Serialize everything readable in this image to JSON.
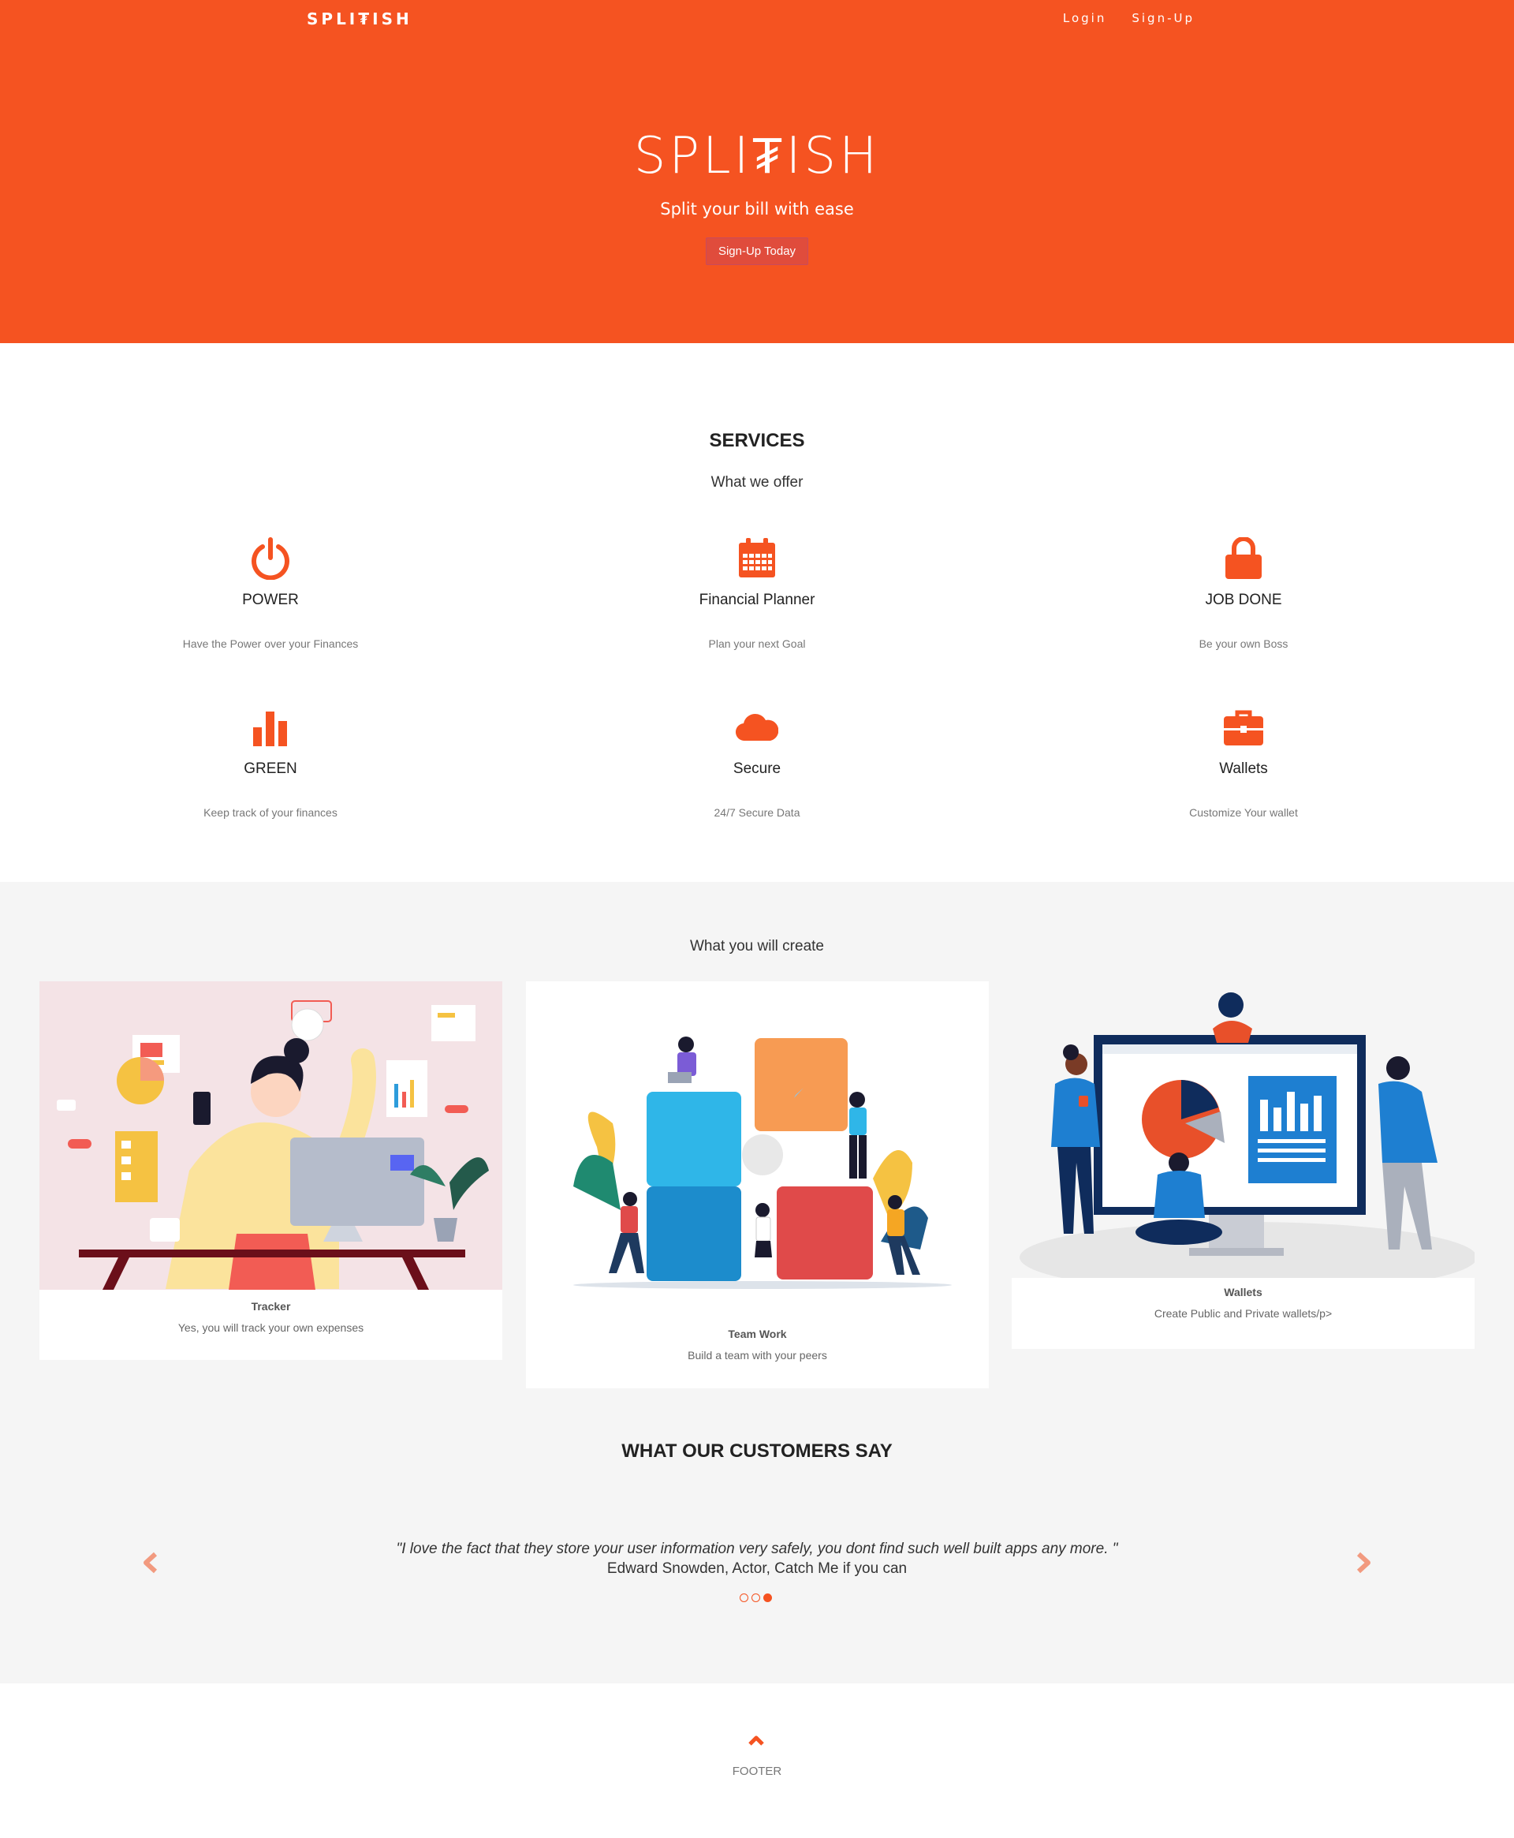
{
  "header": {
    "brand": "SPLI₮ISH",
    "nav": {
      "login": "Login",
      "signup": "Sign-Up"
    }
  },
  "hero": {
    "title": "SPLI₮ISH",
    "subtitle": "Split your bill with ease",
    "cta": "Sign-Up Today"
  },
  "colors": {
    "accent": "#f55321",
    "section_bg": "#f5f5f5"
  },
  "services": {
    "title": "SERVICES",
    "subtitle": "What we offer",
    "items": [
      {
        "icon": "power-icon",
        "name": "POWER",
        "desc": "Have the Power over your Finances"
      },
      {
        "icon": "calendar-icon",
        "name": "Financial Planner",
        "desc": "Plan your next Goal"
      },
      {
        "icon": "lock-icon",
        "name": "JOB DONE",
        "desc": "Be your own Boss"
      },
      {
        "icon": "bar-chart-icon",
        "name": "GREEN",
        "desc": "Keep track of your finances"
      },
      {
        "icon": "cloud-icon",
        "name": "Secure",
        "desc": "24/7 Secure Data"
      },
      {
        "icon": "briefcase-icon",
        "name": "Wallets",
        "desc": "Customize Your wallet"
      }
    ]
  },
  "create": {
    "title": "What you will create",
    "cards": [
      {
        "title": "Tracker",
        "desc": "Yes, you will track your own expenses"
      },
      {
        "title": "Team Work",
        "desc": "Build a team with your peers"
      },
      {
        "title": "Wallets",
        "desc": "Create Public and Private wallets/p>"
      }
    ]
  },
  "testimonials": {
    "title": "WHAT OUR CUSTOMERS SAY",
    "quote": "\"I love the fact that they store your user information very safely, you dont find such well built apps any more. \"",
    "author": "Edward Snowden, Actor, Catch Me if you can",
    "active_index": 2
  },
  "footer": {
    "text": "FOOTER"
  }
}
